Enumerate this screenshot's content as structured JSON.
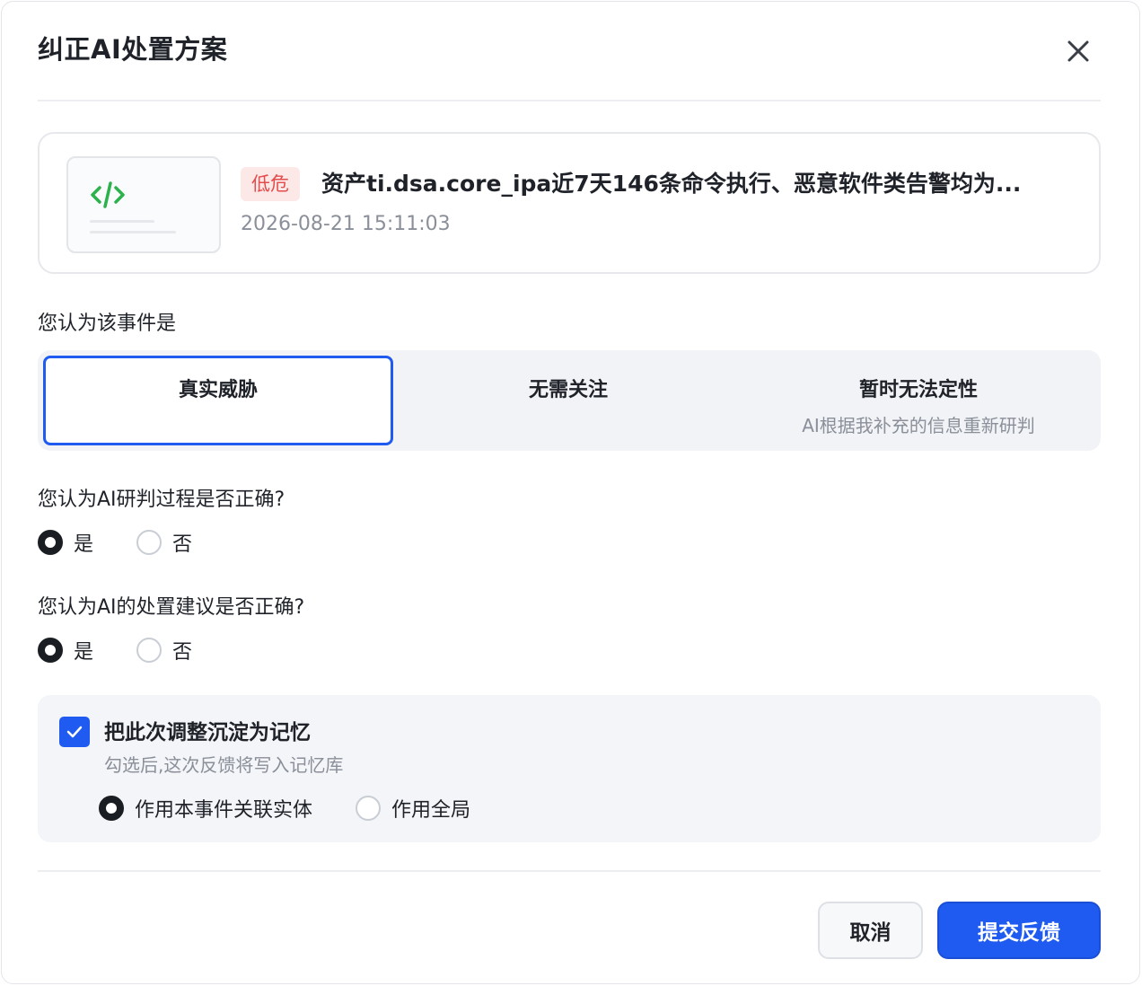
{
  "dialog": {
    "title": "纠正AI处置方案",
    "close_icon": "close-icon"
  },
  "event": {
    "icon": "code-icon",
    "severity": "低危",
    "title": "资产ti.dsa.core_ipa近7天146条命令执行、恶意软件类告警均为...",
    "time": "2026-08-21 15:11:03",
    "colors": {
      "severity_bg": "#fde8e8",
      "severity_text": "#e34d4d"
    }
  },
  "verdict": {
    "label": "您认为该事件是",
    "options": [
      {
        "main": "真实威胁",
        "sub": "",
        "selected": true
      },
      {
        "main": "无需关注",
        "sub": "",
        "selected": false
      },
      {
        "main": "暂时无法定性",
        "sub": "AI根据我补充的信息重新研判",
        "selected": false
      }
    ]
  },
  "q1": {
    "label": "您认为AI研判过程是否正确?",
    "yes": "是",
    "no": "否",
    "selected": "yes"
  },
  "q2": {
    "label": "您认为AI的处置建议是否正确?",
    "yes": "是",
    "no": "否",
    "selected": "yes"
  },
  "memory": {
    "checked": true,
    "title": "把此次调整沉淀为记忆",
    "desc": "勾选后,这次反馈将写入记忆库",
    "scope_entity": "作用本事件关联实体",
    "scope_global": "作用全局",
    "selected_scope": "entity"
  },
  "footer": {
    "cancel": "取消",
    "submit": "提交反馈"
  },
  "colors": {
    "accent": "#1f5bf0"
  }
}
